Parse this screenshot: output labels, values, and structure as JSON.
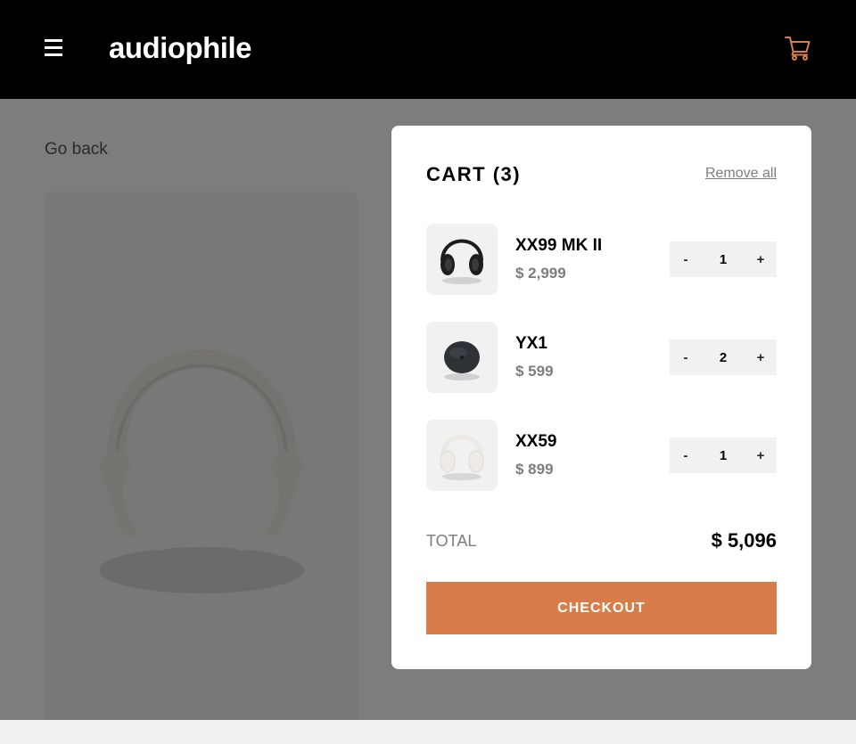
{
  "header": {
    "logo": "audiophile",
    "menu_icon": "hamburger-icon",
    "cart_icon": "cart-icon",
    "accent_color": "#d87d4a"
  },
  "page": {
    "go_back": "Go back"
  },
  "cart": {
    "title": "CART (3)",
    "remove_all": "Remove all",
    "items": [
      {
        "name": "XX99 MK II",
        "price": "$ 2,999",
        "quantity": "1"
      },
      {
        "name": "YX1",
        "price": "$ 599",
        "quantity": "2"
      },
      {
        "name": "XX59",
        "price": "$ 899",
        "quantity": "1"
      }
    ],
    "decrement_label": "-",
    "increment_label": "+",
    "total_label": "TOTAL",
    "total_value": "$ 5,096",
    "checkout_label": "CHECKOUT"
  }
}
